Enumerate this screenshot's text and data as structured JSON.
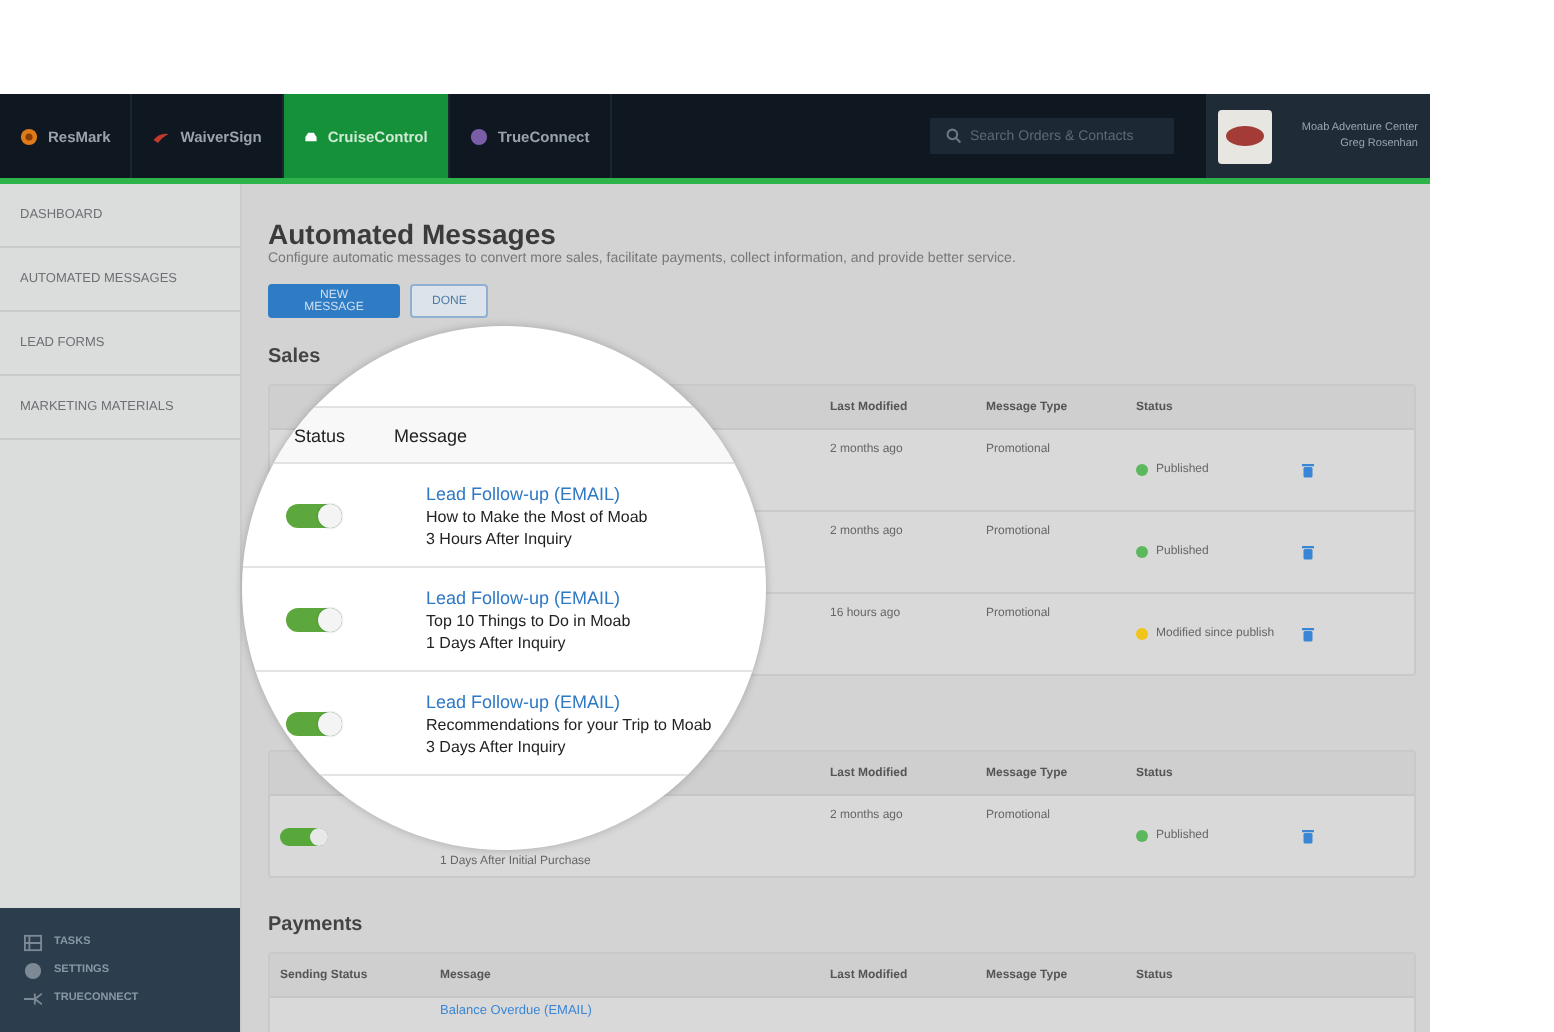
{
  "nav": {
    "products": [
      {
        "label": "ResMark",
        "kind": "resmark",
        "selected": false
      },
      {
        "label": "WaiverSign",
        "kind": "waiversign",
        "selected": false
      },
      {
        "label": "CruiseControl",
        "kind": "cruisecontrol",
        "selected": true
      },
      {
        "label": "TrueConnect",
        "kind": "trueconnect",
        "selected": false
      }
    ],
    "search": {
      "placeholder": "Search Orders & Contacts"
    },
    "account": {
      "name": "Moab Adventure Center",
      "user": "Greg Rosenhan"
    }
  },
  "sidebar": {
    "items": [
      {
        "label": "DASHBOARD"
      },
      {
        "label": "AUTOMATED MESSAGES"
      },
      {
        "label": "LEAD FORMS"
      },
      {
        "label": "MARKETING MATERIALS"
      }
    ],
    "footer": [
      {
        "label": "TASKS",
        "kind": "tasks"
      },
      {
        "label": "SETTINGS",
        "kind": "settings"
      },
      {
        "label": "TRUECONNECT",
        "kind": "connect"
      }
    ]
  },
  "page": {
    "title": "Automated Messages",
    "subtitle": "Configure automatic messages to convert more sales, facilitate payments, collect information, and provide better service.",
    "buttons": [
      {
        "label": "NEW MESSAGE",
        "kind": "primary"
      },
      {
        "label": "DONE",
        "kind": "secondary"
      }
    ]
  },
  "sections": [
    {
      "title": "Sales",
      "columns": [
        {
          "label": "Last Modified",
          "kind": "modified"
        },
        {
          "label": "Message Type",
          "kind": "type"
        },
        {
          "label": "Status",
          "kind": "status"
        }
      ],
      "rows": [
        {
          "modified": "2 months ago",
          "type": "Promotional",
          "status": "Published",
          "color": "#5cb85c"
        },
        {
          "modified": "2 months ago",
          "type": "Promotional",
          "status": "Published",
          "color": "#5cb85c"
        },
        {
          "modified": "16 hours ago",
          "type": "Promotional",
          "status": "Modified since publish",
          "color": "#f0c419"
        }
      ]
    },
    {
      "columns": [
        {
          "label": "Last Modified",
          "kind": "modified"
        },
        {
          "label": "Message Type",
          "kind": "type"
        },
        {
          "label": "Status",
          "kind": "status"
        }
      ],
      "rows": [
        {
          "enabled": true,
          "timing": "1 Days After Initial Purchase",
          "modified": "2 months ago",
          "type": "Promotional",
          "status": "Published",
          "color": "#5cb85c"
        }
      ]
    },
    {
      "title": "Payments",
      "columns": [
        {
          "label": "Sending Status",
          "kind": "toggle"
        },
        {
          "label": "Message",
          "kind": "message"
        },
        {
          "label": "Last Modified",
          "kind": "modified"
        },
        {
          "label": "Message Type",
          "kind": "type"
        },
        {
          "label": "Status",
          "kind": "status"
        }
      ],
      "rows": [
        {
          "link": "Balance Overdue (EMAIL)"
        }
      ]
    }
  ],
  "magnifier": {
    "columns": [
      "Status",
      "Message"
    ],
    "rows": [
      {
        "enabled": true,
        "link": "Lead Follow-up (EMAIL)",
        "title": "How to Make the Most of Moab",
        "timing": "3 Hours After Inquiry"
      },
      {
        "enabled": true,
        "link": "Lead Follow-up (EMAIL)",
        "title": "Top 10 Things to Do in Moab",
        "timing": "1 Days After Inquiry"
      },
      {
        "enabled": true,
        "link": "Lead Follow-up (EMAIL)",
        "title": "Recommendations for your Trip to Moab",
        "timing": "3 Days After Inquiry"
      }
    ]
  }
}
